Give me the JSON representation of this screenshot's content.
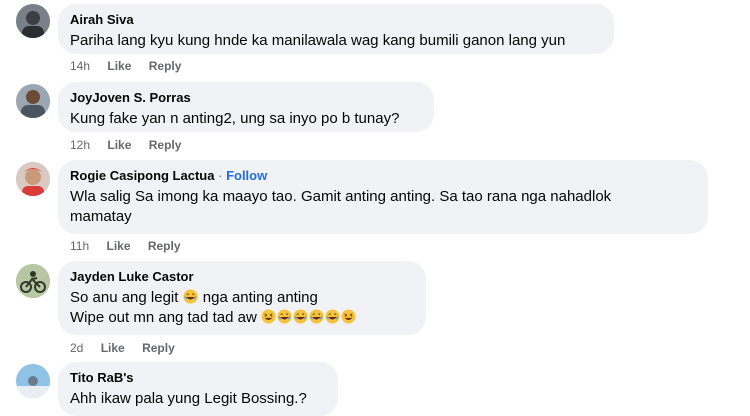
{
  "comments": [
    {
      "name": "Airah Siva",
      "text": "Pariha lang kyu kung hnde ka manilawala wag kang bumili ganon lang yun",
      "time": "14h",
      "like": "Like",
      "reply": "Reply"
    },
    {
      "name": "JoyJoven S. Porras",
      "text": "Kung fake yan n anting2, ung sa inyo po b tunay?",
      "time": "12h",
      "like": "Like",
      "reply": "Reply"
    },
    {
      "name": "Rogie Casipong Lactua",
      "separator": "·",
      "follow": "Follow",
      "text_line1": "Wla salig Sa imong ka maayo tao. Gamit anting anting. Sa tao rana nga nahadlok",
      "text_line2": "mamatay",
      "time": "11h",
      "like": "Like",
      "reply": "Reply"
    },
    {
      "name": "Jayden Luke Castor",
      "text_line1_a": "So anu ang legit",
      "text_line1_b": "nga anting anting",
      "text_line2": "Wipe out mn ang tad tad aw",
      "time": "2d",
      "like": "Like",
      "reply": "Reply"
    },
    {
      "name": "Tito RaB's",
      "text": "Ahh ikaw pala yung Legit Bossing.?"
    }
  ],
  "icons": {
    "laugh_emoji": "laughing-emoji",
    "grin_emoji": "grinning-squinting-emoji"
  },
  "colors": {
    "bubble": "#f0f2f5",
    "follow": "#216fdb",
    "meta": "#65676b"
  }
}
